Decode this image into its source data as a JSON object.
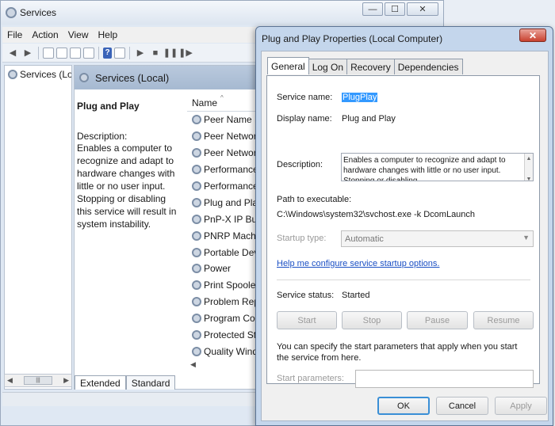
{
  "services_window": {
    "title": "Services",
    "controls": {
      "minimize": "—",
      "maximize": "☐",
      "close": "✕"
    },
    "menu": [
      "File",
      "Action",
      "View",
      "Help"
    ],
    "tree_root": "Services (Loca",
    "panel_header": "Services (Local)",
    "selected_service": {
      "name": "Plug and Play",
      "description_label": "Description:",
      "description": "Enables a computer to recognize and adapt to hardware changes with little or no user input. Stopping or disabling this service will result in system instability."
    },
    "list_header": "Name",
    "services": [
      "Peer Name Re...",
      "Peer Networki...",
      "Peer Networki...",
      "Performance C...",
      "Performance L...",
      "Plug and Play",
      "PnP-X IP Bus E...",
      "PNRP Machine...",
      "Portable Devic...",
      "Power",
      "Print Spooler",
      "Problem Repo...",
      "Program Com...",
      "Protected Stor...",
      "Quality Windo..."
    ],
    "bottom_tabs": [
      "Extended",
      "Standard"
    ]
  },
  "dialog": {
    "title": "Plug and Play Properties (Local Computer)",
    "close_glyph": "✕",
    "tabs": [
      "General",
      "Log On",
      "Recovery",
      "Dependencies"
    ],
    "service_name_label": "Service name:",
    "service_name": "PlugPlay",
    "display_name_label": "Display name:",
    "display_name": "Plug and Play",
    "description_label": "Description:",
    "description": "Enables a computer to recognize and adapt to hardware changes with little or no user input. Stopping or disabling",
    "path_label": "Path to executable:",
    "path": "C:\\Windows\\system32\\svchost.exe -k DcomLaunch",
    "startup_type_label": "Startup type:",
    "startup_type": "Automatic",
    "help_link": "Help me configure service startup options.",
    "status_label": "Service status:",
    "status": "Started",
    "buttons": {
      "start": "Start",
      "stop": "Stop",
      "pause": "Pause",
      "resume": "Resume"
    },
    "params_note": "You can specify the start parameters that apply when you start the service from here.",
    "params_label": "Start parameters:",
    "params_value": "",
    "footer": {
      "ok": "OK",
      "cancel": "Cancel",
      "apply": "Apply"
    }
  }
}
